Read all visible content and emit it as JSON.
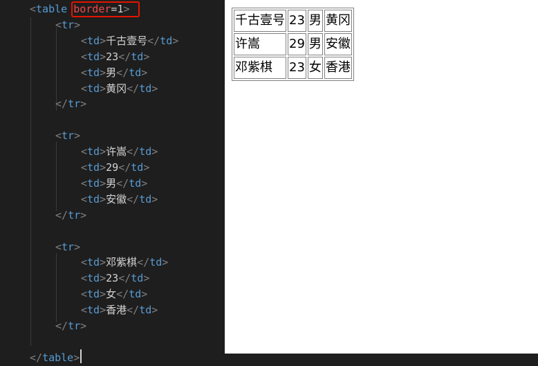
{
  "editor": {
    "lines": [
      {
        "indent": 1,
        "tokens": [
          {
            "c": "sym",
            "t": "<"
          },
          {
            "c": "tag",
            "t": "table"
          },
          {
            "c": "txt",
            "t": " "
          },
          {
            "c": "attr hl",
            "t": "border"
          },
          {
            "c": "eq",
            "t": "="
          },
          {
            "c": "val",
            "t": "1"
          },
          {
            "c": "sym",
            "t": ">"
          }
        ]
      },
      {
        "indent": 2,
        "tokens": [
          {
            "c": "sym",
            "t": "<"
          },
          {
            "c": "tag",
            "t": "tr"
          },
          {
            "c": "sym",
            "t": ">"
          }
        ]
      },
      {
        "indent": 3,
        "tokens": [
          {
            "c": "sym",
            "t": "<"
          },
          {
            "c": "tag",
            "t": "td"
          },
          {
            "c": "sym",
            "t": ">"
          },
          {
            "c": "txt",
            "t": "千古壹号"
          },
          {
            "c": "sym",
            "t": "</"
          },
          {
            "c": "tag",
            "t": "td"
          },
          {
            "c": "sym",
            "t": ">"
          }
        ]
      },
      {
        "indent": 3,
        "tokens": [
          {
            "c": "sym",
            "t": "<"
          },
          {
            "c": "tag",
            "t": "td"
          },
          {
            "c": "sym",
            "t": ">"
          },
          {
            "c": "txt",
            "t": "23"
          },
          {
            "c": "sym",
            "t": "</"
          },
          {
            "c": "tag",
            "t": "td"
          },
          {
            "c": "sym",
            "t": ">"
          }
        ]
      },
      {
        "indent": 3,
        "tokens": [
          {
            "c": "sym",
            "t": "<"
          },
          {
            "c": "tag",
            "t": "td"
          },
          {
            "c": "sym",
            "t": ">"
          },
          {
            "c": "txt",
            "t": "男"
          },
          {
            "c": "sym",
            "t": "</"
          },
          {
            "c": "tag",
            "t": "td"
          },
          {
            "c": "sym",
            "t": ">"
          }
        ]
      },
      {
        "indent": 3,
        "tokens": [
          {
            "c": "sym",
            "t": "<"
          },
          {
            "c": "tag",
            "t": "td"
          },
          {
            "c": "sym",
            "t": ">"
          },
          {
            "c": "txt",
            "t": "黄冈"
          },
          {
            "c": "sym",
            "t": "</"
          },
          {
            "c": "tag",
            "t": "td"
          },
          {
            "c": "sym",
            "t": ">"
          }
        ]
      },
      {
        "indent": 2,
        "tokens": [
          {
            "c": "sym",
            "t": "</"
          },
          {
            "c": "tag",
            "t": "tr"
          },
          {
            "c": "sym",
            "t": ">"
          }
        ]
      },
      {
        "indent": 0,
        "tokens": []
      },
      {
        "indent": 2,
        "tokens": [
          {
            "c": "sym",
            "t": "<"
          },
          {
            "c": "tag",
            "t": "tr"
          },
          {
            "c": "sym",
            "t": ">"
          }
        ]
      },
      {
        "indent": 3,
        "tokens": [
          {
            "c": "sym",
            "t": "<"
          },
          {
            "c": "tag",
            "t": "td"
          },
          {
            "c": "sym",
            "t": ">"
          },
          {
            "c": "txt",
            "t": "许嵩"
          },
          {
            "c": "sym",
            "t": "</"
          },
          {
            "c": "tag",
            "t": "td"
          },
          {
            "c": "sym",
            "t": ">"
          }
        ]
      },
      {
        "indent": 3,
        "tokens": [
          {
            "c": "sym",
            "t": "<"
          },
          {
            "c": "tag",
            "t": "td"
          },
          {
            "c": "sym",
            "t": ">"
          },
          {
            "c": "txt",
            "t": "29"
          },
          {
            "c": "sym",
            "t": "</"
          },
          {
            "c": "tag",
            "t": "td"
          },
          {
            "c": "sym",
            "t": ">"
          }
        ]
      },
      {
        "indent": 3,
        "tokens": [
          {
            "c": "sym",
            "t": "<"
          },
          {
            "c": "tag",
            "t": "td"
          },
          {
            "c": "sym",
            "t": ">"
          },
          {
            "c": "txt",
            "t": "男"
          },
          {
            "c": "sym",
            "t": "</"
          },
          {
            "c": "tag",
            "t": "td"
          },
          {
            "c": "sym",
            "t": ">"
          }
        ]
      },
      {
        "indent": 3,
        "tokens": [
          {
            "c": "sym",
            "t": "<"
          },
          {
            "c": "tag",
            "t": "td"
          },
          {
            "c": "sym",
            "t": ">"
          },
          {
            "c": "txt",
            "t": "安徽"
          },
          {
            "c": "sym",
            "t": "</"
          },
          {
            "c": "tag",
            "t": "td"
          },
          {
            "c": "sym",
            "t": ">"
          }
        ]
      },
      {
        "indent": 2,
        "tokens": [
          {
            "c": "sym",
            "t": "</"
          },
          {
            "c": "tag",
            "t": "tr"
          },
          {
            "c": "sym",
            "t": ">"
          }
        ]
      },
      {
        "indent": 0,
        "tokens": []
      },
      {
        "indent": 2,
        "tokens": [
          {
            "c": "sym",
            "t": "<"
          },
          {
            "c": "tag",
            "t": "tr"
          },
          {
            "c": "sym",
            "t": ">"
          }
        ]
      },
      {
        "indent": 3,
        "tokens": [
          {
            "c": "sym",
            "t": "<"
          },
          {
            "c": "tag",
            "t": "td"
          },
          {
            "c": "sym",
            "t": ">"
          },
          {
            "c": "txt",
            "t": "邓紫棋"
          },
          {
            "c": "sym",
            "t": "</"
          },
          {
            "c": "tag",
            "t": "td"
          },
          {
            "c": "sym",
            "t": ">"
          }
        ]
      },
      {
        "indent": 3,
        "tokens": [
          {
            "c": "sym",
            "t": "<"
          },
          {
            "c": "tag",
            "t": "td"
          },
          {
            "c": "sym",
            "t": ">"
          },
          {
            "c": "txt",
            "t": "23"
          },
          {
            "c": "sym",
            "t": "</"
          },
          {
            "c": "tag",
            "t": "td"
          },
          {
            "c": "sym",
            "t": ">"
          }
        ]
      },
      {
        "indent": 3,
        "tokens": [
          {
            "c": "sym",
            "t": "<"
          },
          {
            "c": "tag",
            "t": "td"
          },
          {
            "c": "sym",
            "t": ">"
          },
          {
            "c": "txt",
            "t": "女"
          },
          {
            "c": "sym",
            "t": "</"
          },
          {
            "c": "tag",
            "t": "td"
          },
          {
            "c": "sym",
            "t": ">"
          }
        ]
      },
      {
        "indent": 3,
        "tokens": [
          {
            "c": "sym",
            "t": "<"
          },
          {
            "c": "tag",
            "t": "td"
          },
          {
            "c": "sym",
            "t": ">"
          },
          {
            "c": "txt",
            "t": "香港"
          },
          {
            "c": "sym",
            "t": "</"
          },
          {
            "c": "tag",
            "t": "td"
          },
          {
            "c": "sym",
            "t": ">"
          }
        ]
      },
      {
        "indent": 2,
        "tokens": [
          {
            "c": "sym",
            "t": "</"
          },
          {
            "c": "tag",
            "t": "tr"
          },
          {
            "c": "sym",
            "t": ">"
          }
        ]
      },
      {
        "indent": 0,
        "tokens": []
      },
      {
        "indent": 1,
        "tokens": [
          {
            "c": "sym",
            "t": "</"
          },
          {
            "c": "tag",
            "t": "table"
          },
          {
            "c": "sym",
            "t": ">"
          }
        ]
      }
    ]
  },
  "preview": {
    "rows": [
      [
        "千古壹号",
        "23",
        "男",
        "黄冈"
      ],
      [
        "许嵩",
        "29",
        "男",
        "安徽"
      ],
      [
        "邓紫棋",
        "23",
        "女",
        "香港"
      ]
    ]
  },
  "colors": {
    "editor_bg": "#1e1e1e",
    "tag": "#569cd6",
    "attribute": "#9cdcfe",
    "highlight_border": "#e51400",
    "preview_bg": "#ffffff"
  }
}
